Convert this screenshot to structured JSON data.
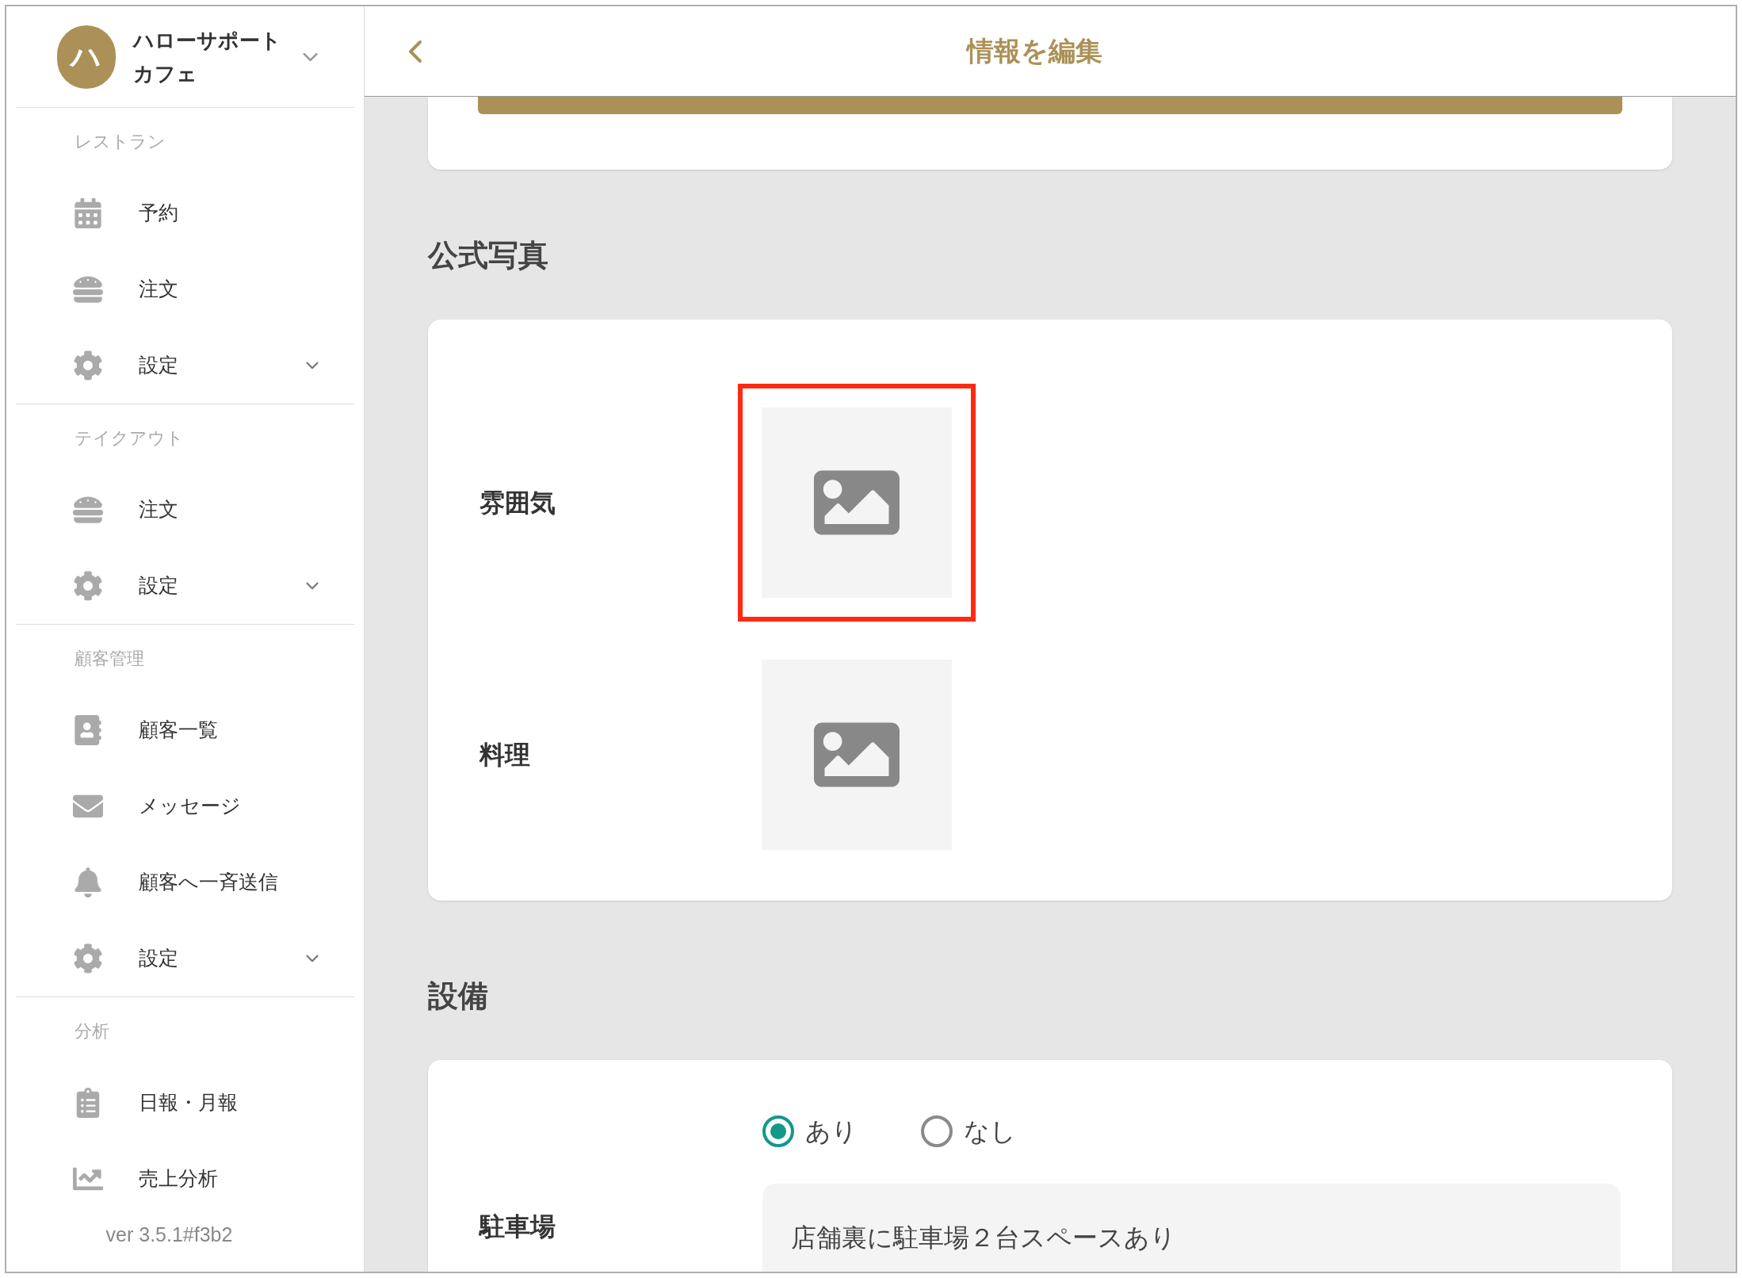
{
  "account": {
    "initial": "ハ",
    "name": "ハローサポートカフェ",
    "expanded": false
  },
  "sidebar": {
    "sections": [
      {
        "title": "レストラン",
        "items": [
          {
            "kind": "calendar",
            "label": "予約"
          },
          {
            "kind": "order",
            "label": "注文"
          },
          {
            "kind": "settings",
            "label": "設定",
            "expanded": false
          }
        ]
      },
      {
        "title": "テイクアウト",
        "items": [
          {
            "kind": "order",
            "label": "注文"
          },
          {
            "kind": "settings",
            "label": "設定",
            "expanded": false
          }
        ]
      },
      {
        "title": "顧客管理",
        "items": [
          {
            "kind": "contacts",
            "label": "顧客一覧"
          },
          {
            "kind": "mail",
            "label": "メッセージ"
          },
          {
            "kind": "bell",
            "label": "顧客へ一斉送信"
          },
          {
            "kind": "settings",
            "label": "設定",
            "expanded": false
          }
        ]
      },
      {
        "title": "分析",
        "items": [
          {
            "kind": "clipboard",
            "label": "日報・月報"
          },
          {
            "kind": "chart",
            "label": "売上分析"
          }
        ]
      }
    ],
    "version": "ver 3.5.1#f3b2"
  },
  "header": {
    "title": "情報を編集"
  },
  "photos": {
    "heading": "公式写真",
    "items": [
      {
        "label": "雰囲気",
        "highlighted": true
      },
      {
        "label": "料理",
        "highlighted": false
      }
    ]
  },
  "facilities": {
    "heading": "設備",
    "rows": [
      {
        "label": "駐車場",
        "options": [
          {
            "label": "あり",
            "selected": true
          },
          {
            "label": "なし",
            "selected": false
          }
        ],
        "value": "店舗裏に駐車場２台スペースあり"
      }
    ]
  }
}
